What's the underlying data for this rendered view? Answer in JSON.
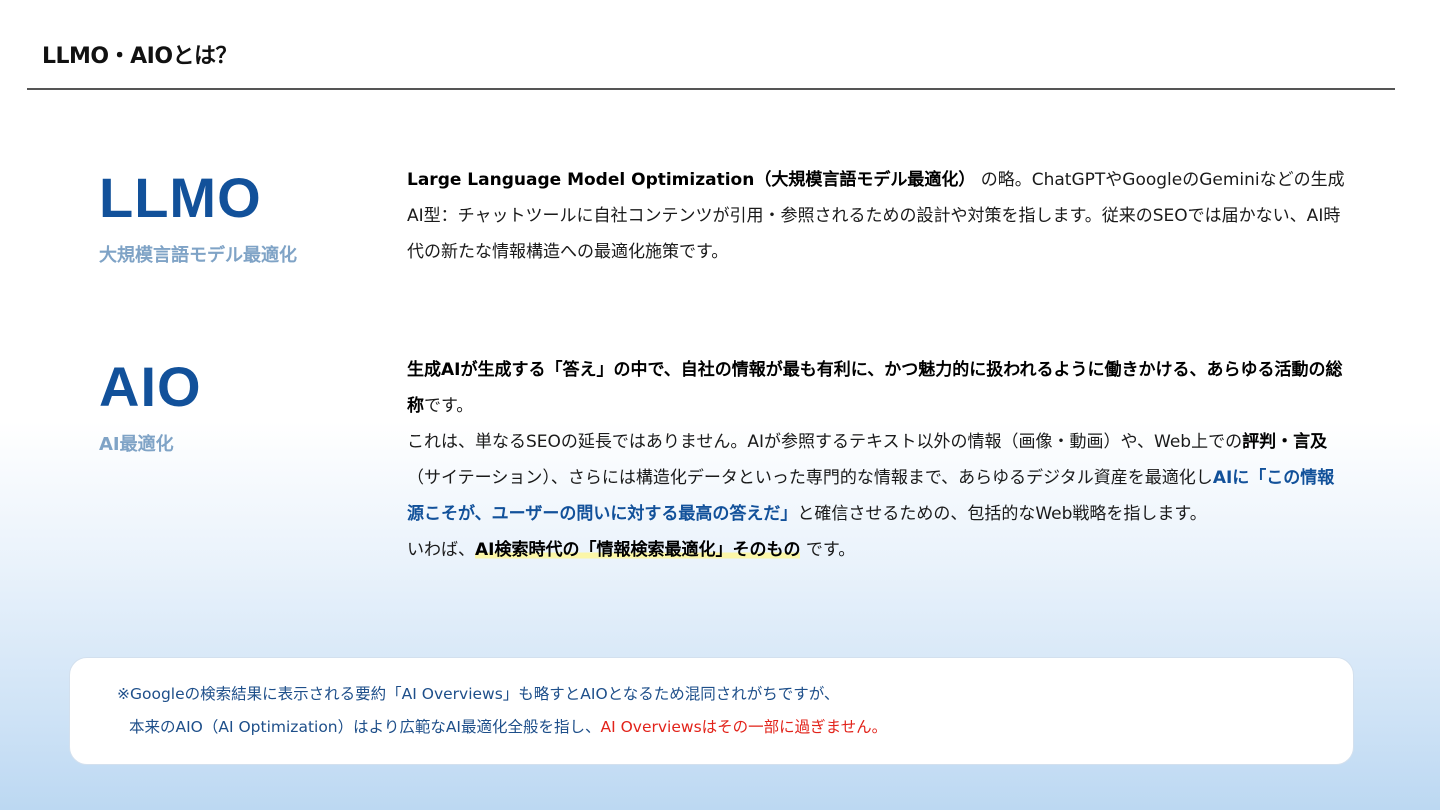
{
  "header": {
    "title": "LLMO・AIOとは？"
  },
  "llmo": {
    "term": "LLMO",
    "subtitle": "大規模言語モデル最適化",
    "desc_bold": "Large Language Model Optimization（大規模言語モデル最適化）",
    "desc_rest": " の略。ChatGPTやGoogleのGeminiなどの生成AI型：チャットツールに自社コンテンツが引用・参照されるための設計や対策を指します。従来のSEOでは届かない、AI時代の新たな情報構造への最適化施策です。"
  },
  "aio": {
    "term": "AIO",
    "subtitle": "AI最適化",
    "p1_bold": "生成AIが生成する「答え」の中で、自社の情報が最も有利に、かつ魅力的に扱われるように働きかける、あらゆる活動の総称",
    "p1_rest": "です。",
    "p2_start": "これは、単なるSEOの延長ではありません。AIが参照するテキスト以外の情報（画像・動画）や、Web上での",
    "p2_bold": "評判・言及",
    "p2_mid": "（サイテーション）、さらには構造化データといった専門的な情報まで、あらゆるデジタル資産を最適化し",
    "p2_blue": "AIに「この情報源こそが、ユーザーの問いに対する最高の答えだ」",
    "p2_end": "と確信させるための、包括的なWeb戦略を指します。",
    "p3_start": "いわば、",
    "p3_highlight": "AI検索時代の「情報検索最適化」そのもの",
    "p3_end": " です。"
  },
  "note": {
    "line1": "※Googleの検索結果に表示される要約「AI Overviews」も略すとAIOとなるため混同されがちですが、",
    "line2_start": "本来のAIO（AI Optimization）はより広範なAI最適化全般を指し、",
    "line2_red": "AI Overviewsはその一部に過ぎません。"
  },
  "colors": {
    "accent": "#12519a",
    "subtitle": "#7fa3c6",
    "note_text": "#1e4f8a",
    "warning": "#e2231a",
    "highlight": "#fbf6a8"
  }
}
